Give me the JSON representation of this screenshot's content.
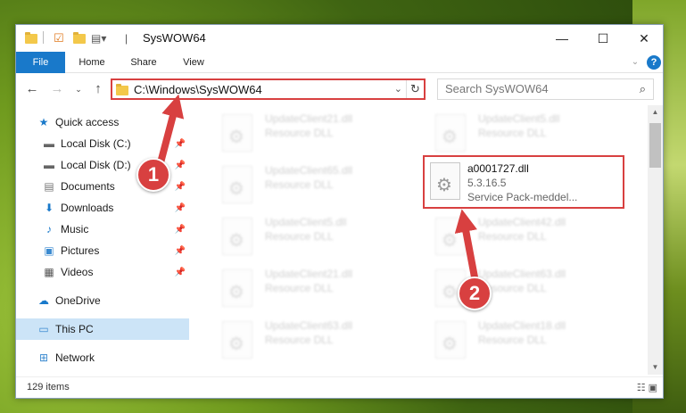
{
  "window": {
    "title": "SysWOW64",
    "buttons": {
      "minimize": "—",
      "maximize": "☐",
      "close": "✕"
    }
  },
  "ribbon": {
    "tabs": [
      "File",
      "Home",
      "Share",
      "View"
    ],
    "help": "?"
  },
  "address": {
    "path": "C:\\Windows\\SysWOW64",
    "search_placeholder": "Search SysWOW64"
  },
  "nav": {
    "items": [
      {
        "label": "Quick access",
        "icon": "star-icon",
        "glyph": "★"
      },
      {
        "label": "Local Disk (C:)",
        "icon": "drive-icon",
        "glyph": "▬"
      },
      {
        "label": "Local Disk (D:)",
        "icon": "drive-icon",
        "glyph": "▬"
      },
      {
        "label": "Documents",
        "icon": "documents-icon",
        "glyph": "▤"
      },
      {
        "label": "Downloads",
        "icon": "downloads-icon",
        "glyph": "⬇"
      },
      {
        "label": "Music",
        "icon": "music-icon",
        "glyph": "♪"
      },
      {
        "label": "Pictures",
        "icon": "pictures-icon",
        "glyph": "▣"
      },
      {
        "label": "Videos",
        "icon": "videos-icon",
        "glyph": "▦"
      },
      {
        "label": "OneDrive",
        "icon": "onedrive-icon",
        "glyph": "☁"
      },
      {
        "label": "This PC",
        "icon": "pc-icon",
        "glyph": "▭"
      },
      {
        "label": "Network",
        "icon": "network-icon",
        "glyph": "⊞"
      }
    ]
  },
  "files": {
    "left": [
      {
        "name": "UpdateClient21.dll",
        "desc": "Resource DLL"
      },
      {
        "name": "UpdateClient65.dll",
        "desc": "Resource DLL"
      },
      {
        "name": "UpdateClient5.dll",
        "desc": "Resource DLL"
      },
      {
        "name": "UpdateClient21.dll",
        "desc": "Resource DLL"
      },
      {
        "name": "UpdateClient63.dll",
        "desc": "Resource DLL"
      }
    ],
    "right": [
      {
        "name": "UpdateClient5.dll",
        "desc": "Resource DLL"
      },
      {
        "name": "UpdateClient42.dll",
        "desc": "Resource DLL"
      },
      {
        "name": "UpdateClient63.dll",
        "desc": "Resource DLL"
      },
      {
        "name": "UpdateClient18.dll",
        "desc": "Resource DLL"
      }
    ],
    "highlighted": {
      "name": "a0001727.dll",
      "version": "5.3.16.5",
      "desc": "Service Pack-meddel..."
    }
  },
  "status": {
    "count": "129 items"
  },
  "callouts": {
    "one": "1",
    "two": "2",
    "color": "#d84040"
  }
}
